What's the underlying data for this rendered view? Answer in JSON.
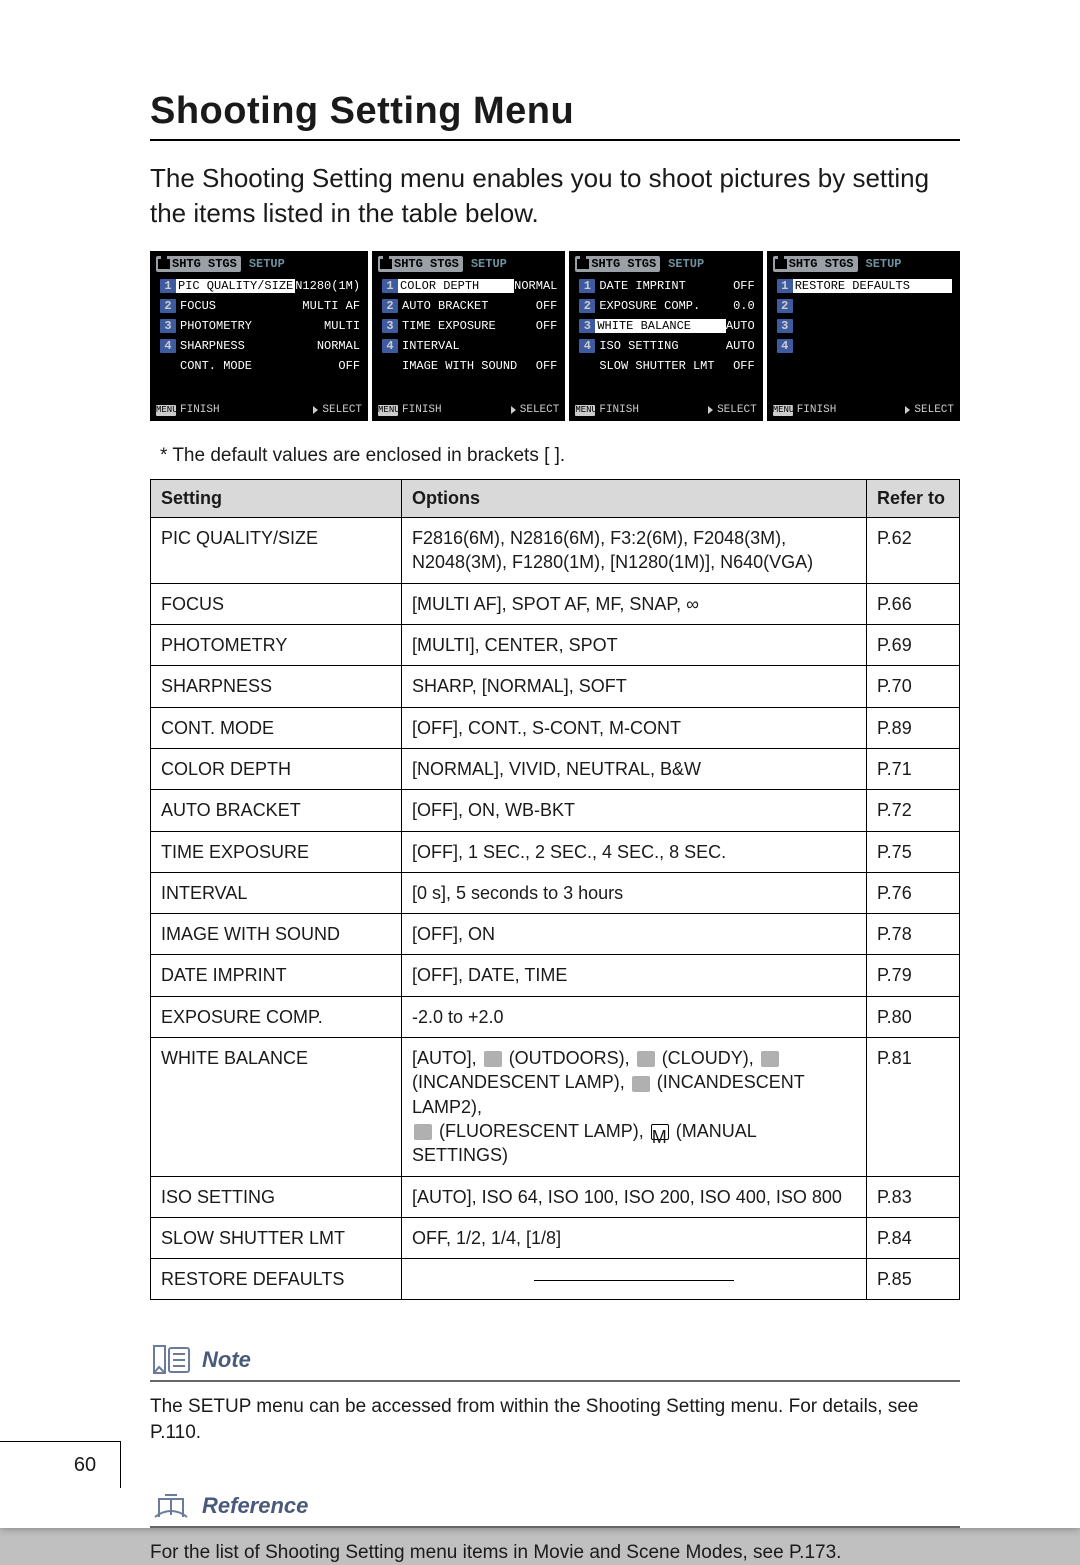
{
  "title": "Shooting Setting Menu",
  "intro": "The Shooting Setting menu enables you to shoot pictures by setting the items listed in the table below.",
  "lcd_common": {
    "tab_active": "SHTG STGS",
    "tab_inactive": "SETUP",
    "footer_left": "FINISH",
    "footer_right": "SELECT"
  },
  "lcd_panels": [
    {
      "selected_index": 0,
      "rows": [
        {
          "idx": "1",
          "label": "PIC QUALITY/SIZE",
          "val": "N1280(1M)"
        },
        {
          "idx": "2",
          "label": "FOCUS",
          "val": "MULTI AF"
        },
        {
          "idx": "3",
          "label": "PHOTOMETRY",
          "val": "MULTI"
        },
        {
          "idx": "4",
          "label": "SHARPNESS",
          "val": "NORMAL"
        },
        {
          "idx": "",
          "label": "CONT. MODE",
          "val": "OFF"
        }
      ]
    },
    {
      "selected_index": 0,
      "rows": [
        {
          "idx": "1",
          "label": "COLOR DEPTH",
          "val": "NORMAL"
        },
        {
          "idx": "2",
          "label": "AUTO BRACKET",
          "val": "OFF"
        },
        {
          "idx": "3",
          "label": "TIME EXPOSURE",
          "val": "OFF"
        },
        {
          "idx": "4",
          "label": "INTERVAL",
          "val": ""
        },
        {
          "idx": "",
          "label": "IMAGE WITH SOUND",
          "val": "OFF"
        }
      ]
    },
    {
      "selected_index": 2,
      "rows": [
        {
          "idx": "1",
          "label": "DATE IMPRINT",
          "val": "OFF"
        },
        {
          "idx": "2",
          "label": "EXPOSURE COMP.",
          "val": "0.0"
        },
        {
          "idx": "3",
          "label": "WHITE BALANCE",
          "val": "AUTO"
        },
        {
          "idx": "4",
          "label": "ISO SETTING",
          "val": "AUTO"
        },
        {
          "idx": "",
          "label": "SLOW SHUTTER LMT",
          "val": "OFF"
        }
      ]
    },
    {
      "selected_index": 0,
      "rows": [
        {
          "idx": "1",
          "label": "RESTORE DEFAULTS",
          "val": ""
        },
        {
          "idx": "2",
          "label": "",
          "val": ""
        },
        {
          "idx": "3",
          "label": "",
          "val": ""
        },
        {
          "idx": "4",
          "label": "",
          "val": ""
        },
        {
          "idx": "",
          "label": "",
          "val": ""
        }
      ]
    }
  ],
  "footnote": "* The default values are enclosed in brackets [ ].",
  "table_headers": {
    "setting": "Setting",
    "options": "Options",
    "refer": "Refer to"
  },
  "settings_rows": [
    {
      "setting": "PIC QUALITY/SIZE",
      "options": "F2816(6M), N2816(6M), F3:2(6M), F2048(3M), N2048(3M), F1280(1M), [N1280(1M)], N640(VGA)",
      "refer": "P.62"
    },
    {
      "setting": "FOCUS",
      "options": "[MULTI AF], SPOT AF, MF, SNAP, ∞",
      "refer": "P.66"
    },
    {
      "setting": "PHOTOMETRY",
      "options": "[MULTI], CENTER, SPOT",
      "refer": "P.69"
    },
    {
      "setting": "SHARPNESS",
      "options": "SHARP, [NORMAL], SOFT",
      "refer": "P.70"
    },
    {
      "setting": "CONT. MODE",
      "options": "[OFF], CONT., S-CONT, M-CONT",
      "refer": "P.89"
    },
    {
      "setting": "COLOR DEPTH",
      "options": "[NORMAL], VIVID, NEUTRAL, B&W",
      "refer": "P.71"
    },
    {
      "setting": "AUTO BRACKET",
      "options": "[OFF], ON, WB-BKT",
      "refer": "P.72"
    },
    {
      "setting": "TIME EXPOSURE",
      "options": "[OFF], 1 SEC., 2 SEC., 4 SEC., 8 SEC.",
      "refer": "P.75"
    },
    {
      "setting": "INTERVAL",
      "options": "[0 s], 5 seconds to 3 hours",
      "refer": "P.76"
    },
    {
      "setting": "IMAGE WITH SOUND",
      "options": "[OFF], ON",
      "refer": "P.78"
    },
    {
      "setting": "DATE IMPRINT",
      "options": "[OFF], DATE, TIME",
      "refer": "P.79"
    },
    {
      "setting": "EXPOSURE COMP.",
      "options": "-2.0 to +2.0",
      "refer": "P.80"
    },
    {
      "setting": "WHITE BALANCE",
      "options_rich": true,
      "refer": "P.81",
      "wb_parts": {
        "p1": "[AUTO], ",
        "outdoors": " (OUTDOORS), ",
        "cloudy": " (CLOUDY), ",
        "inc1": "(INCANDESCENT LAMP), ",
        "inc2": " (INCANDESCENT LAMP2),",
        "fluor": " (FLUORESCENT LAMP), ",
        "manual": " (MANUAL SETTINGS)"
      }
    },
    {
      "setting": "ISO SETTING",
      "options": "[AUTO], ISO 64, ISO 100, ISO 200, ISO 400, ISO 800",
      "refer": "P.83"
    },
    {
      "setting": "SLOW SHUTTER LMT",
      "options": "OFF, 1/2, 1/4, [1/8]",
      "refer": "P.84"
    },
    {
      "setting": "RESTORE DEFAULTS",
      "options_dash": true,
      "refer": "P.85"
    }
  ],
  "note": {
    "title": "Note",
    "body": "The SETUP menu can be accessed from within the Shooting Setting menu. For details, see P.110."
  },
  "reference": {
    "title": "Reference",
    "body": "For the list of Shooting Setting menu items in Movie and Scene Modes, see P.173."
  },
  "page_number": "60",
  "icons": {
    "menu_btn": "MENU"
  }
}
